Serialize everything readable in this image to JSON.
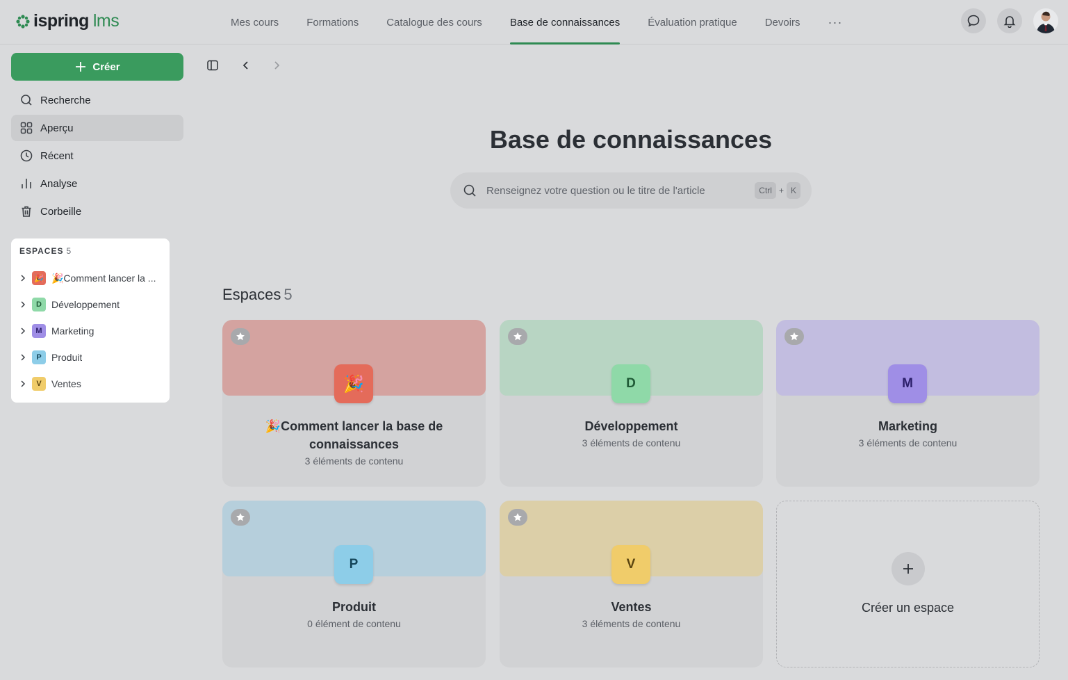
{
  "app": {
    "logo_main": "ispring",
    "logo_sub": "lms"
  },
  "nav": {
    "items": [
      {
        "label": "Mes cours"
      },
      {
        "label": "Formations"
      },
      {
        "label": "Catalogue des cours"
      },
      {
        "label": "Base de connaissances",
        "active": true
      },
      {
        "label": "Évaluation pratique"
      },
      {
        "label": "Devoirs"
      }
    ],
    "more": "···"
  },
  "sidebar": {
    "create_label": "Créer",
    "menu": [
      {
        "label": "Recherche",
        "icon": "search-icon"
      },
      {
        "label": "Aperçu",
        "icon": "grid-icon",
        "active": true
      },
      {
        "label": "Récent",
        "icon": "clock-icon"
      },
      {
        "label": "Analyse",
        "icon": "bar-chart-icon"
      },
      {
        "label": "Corbeille",
        "icon": "trash-icon"
      }
    ],
    "spaces_title": "ESPACES",
    "spaces_count": "5",
    "spaces": [
      {
        "label": "🎉Comment lancer la ...",
        "badge": "🎉",
        "color": "#e46b5a"
      },
      {
        "label": "Développement",
        "badge": "D",
        "color": "#8fd9a8"
      },
      {
        "label": "Marketing",
        "badge": "M",
        "color": "#9f8ee6"
      },
      {
        "label": "Produit",
        "badge": "P",
        "color": "#8dcde8"
      },
      {
        "label": "Ventes",
        "badge": "V",
        "color": "#f0cc6a"
      }
    ]
  },
  "main": {
    "title": "Base de connaissances",
    "search": {
      "placeholder": "Renseignez votre question ou le titre de l'article",
      "kbd_ctrl": "Ctrl",
      "kbd_plus": "+",
      "kbd_k": "K"
    },
    "section_title": "Espaces",
    "section_count": "5",
    "cards": [
      {
        "name": "🎉Comment lancer la base de connaissances",
        "badge": "🎉",
        "meta": "3 éléments de contenu",
        "banner": "#d4a3a0",
        "badge_bg": "#e46b5a",
        "badge_fg": "#ffffff"
      },
      {
        "name": "Développement",
        "badge": "D",
        "meta": "3 éléments de contenu",
        "banner": "#b8d5c3",
        "badge_bg": "#8fd9a8",
        "badge_fg": "#1f5b36"
      },
      {
        "name": "Marketing",
        "badge": "M",
        "meta": "3 éléments de contenu",
        "banner": "#c2bde0",
        "badge_bg": "#9f8ee6",
        "badge_fg": "#2c1f6b"
      },
      {
        "name": "Produit",
        "badge": "P",
        "meta": "0 élément de contenu",
        "banner": "#b6cfdc",
        "badge_bg": "#8dcde8",
        "badge_fg": "#144559"
      },
      {
        "name": "Ventes",
        "badge": "V",
        "meta": "3 éléments de contenu",
        "banner": "#dccfa8",
        "badge_bg": "#f0cc6a",
        "badge_fg": "#5b4510"
      }
    ],
    "create_space_label": "Créer un espace"
  },
  "colors": {
    "accent": "#2e8a52",
    "create_button": "#3a9b5e"
  }
}
